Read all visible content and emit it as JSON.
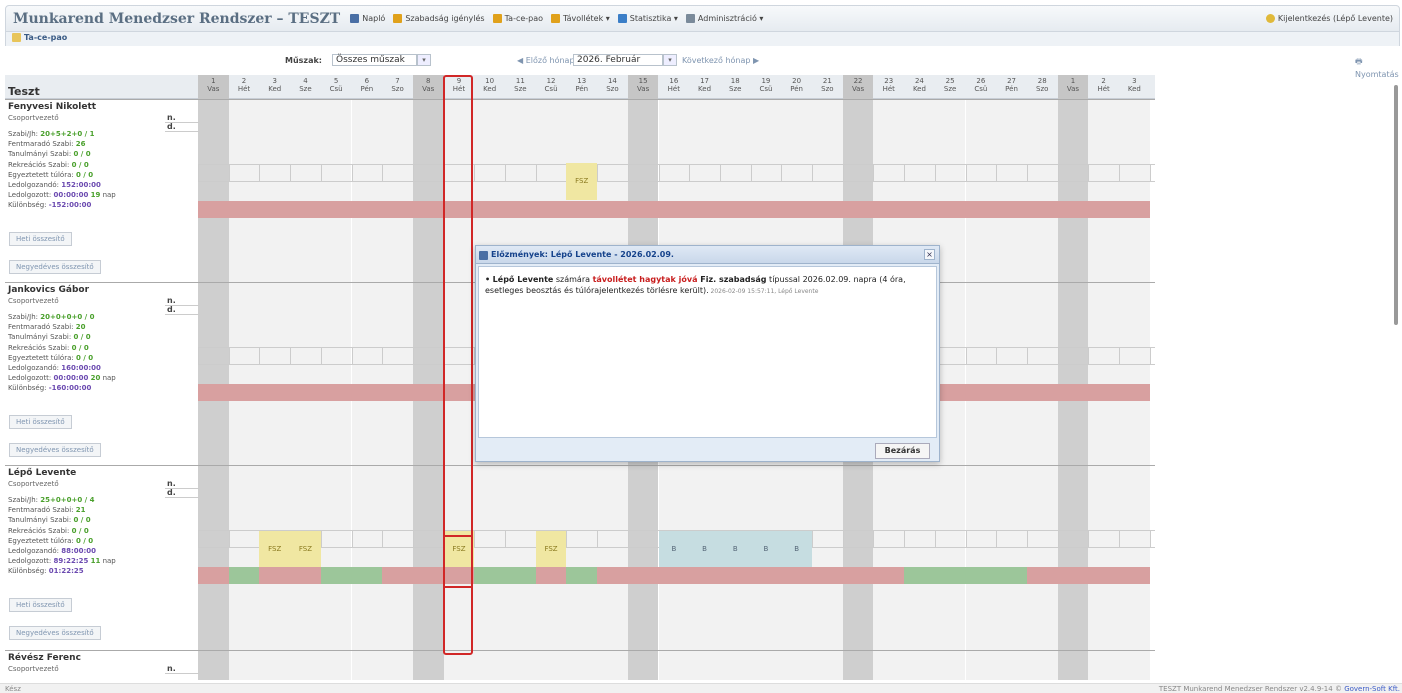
{
  "app": {
    "title": "Munkarend Menedzser Rendszer – TESZT",
    "logout": "Kijelentkezés (Lépő Levente)"
  },
  "menu": [
    {
      "label": "Napló",
      "icon": "book-icon",
      "color": "#4a6fa5"
    },
    {
      "label": "Szabadság igénylés",
      "icon": "home-icon",
      "color": "#e0a11b"
    },
    {
      "label": "Ta-ce-pao",
      "icon": "calendar-icon",
      "color": "#e0a11b"
    },
    {
      "label": "Távollétek ▾",
      "icon": "home-icon",
      "color": "#e0a11b"
    },
    {
      "label": "Statisztika ▾",
      "icon": "chart-icon",
      "color": "#3b7ec7"
    },
    {
      "label": "Adminisztráció ▾",
      "icon": "window-icon",
      "color": "#7a8a9a"
    }
  ],
  "tab": "Ta-ce-pao",
  "filters": {
    "shift_label": "Műszak:",
    "shift_value": "Összes műszak",
    "prev": "Előző hónap",
    "month": "2026. Február",
    "next": "Következő hónap",
    "print": "Nyomtatás"
  },
  "grid": {
    "title": "Teszt"
  },
  "days": [
    {
      "n": "1",
      "d": "Vas",
      "we": true
    },
    {
      "n": "2",
      "d": "Hét"
    },
    {
      "n": "3",
      "d": "Ked"
    },
    {
      "n": "4",
      "d": "Sze"
    },
    {
      "n": "5",
      "d": "Csü"
    },
    {
      "n": "6",
      "d": "Pén"
    },
    {
      "n": "7",
      "d": "Szo"
    },
    {
      "n": "8",
      "d": "Vas",
      "we": true
    },
    {
      "n": "9",
      "d": "Hét"
    },
    {
      "n": "10",
      "d": "Ked"
    },
    {
      "n": "11",
      "d": "Sze"
    },
    {
      "n": "12",
      "d": "Csü"
    },
    {
      "n": "13",
      "d": "Pén"
    },
    {
      "n": "14",
      "d": "Szo"
    },
    {
      "n": "15",
      "d": "Vas",
      "we": true
    },
    {
      "n": "16",
      "d": "Hét"
    },
    {
      "n": "17",
      "d": "Ked"
    },
    {
      "n": "18",
      "d": "Sze"
    },
    {
      "n": "19",
      "d": "Csü"
    },
    {
      "n": "20",
      "d": "Pén"
    },
    {
      "n": "21",
      "d": "Szo"
    },
    {
      "n": "22",
      "d": "Vas",
      "we": true
    },
    {
      "n": "23",
      "d": "Hét"
    },
    {
      "n": "24",
      "d": "Ked"
    },
    {
      "n": "25",
      "d": "Sze"
    },
    {
      "n": "26",
      "d": "Csü"
    },
    {
      "n": "27",
      "d": "Pén"
    },
    {
      "n": "28",
      "d": "Szo"
    },
    {
      "n": "1",
      "d": "Vas",
      "we": true
    },
    {
      "n": "2",
      "d": "Hét"
    },
    {
      "n": "3",
      "d": "Ked"
    }
  ],
  "people": [
    {
      "name": "Fenyvesi Nikolett",
      "role": "Csoportvezető",
      "s1": "Szabi/Jh:",
      "v1": "20+5+2+0 / 1",
      "s2": "Fentmaradó Szabi:",
      "v2": "26",
      "s3": "Tanulmányi Szabi:",
      "v3": "0 / 0",
      "s4": "Rekreációs Szabi:",
      "v4": "0 / 0",
      "s5": "Egyeztetett túlóra:",
      "v5": "0 / 0",
      "s6": "Ledolgozandó:",
      "v6": "152:00:00",
      "s7": "Ledolgozott:",
      "v7": "00:00:00",
      "v7b": "19",
      "v7c": "nap",
      "s8": "Különbség:",
      "v8": "-152:00:00"
    },
    {
      "name": "Jankovics Gábor",
      "role": "Csoportvezető",
      "s1": "Szabi/Jh:",
      "v1": "20+0+0+0 / 0",
      "s2": "Fentmaradó Szabi:",
      "v2": "20",
      "s3": "Tanulmányi Szabi:",
      "v3": "0 / 0",
      "s4": "Rekreációs Szabi:",
      "v4": "0 / 0",
      "s5": "Egyeztetett túlóra:",
      "v5": "0 / 0",
      "s6": "Ledolgozandó:",
      "v6": "160:00:00",
      "s7": "Ledolgozott:",
      "v7": "00:00:00",
      "v7b": "20",
      "v7c": "nap",
      "s8": "Különbség:",
      "v8": "-160:00:00"
    },
    {
      "name": "Lépő Levente",
      "role": "Csoportvezető",
      "s1": "Szabi/Jh:",
      "v1": "25+0+0+0 / 4",
      "s2": "Fentmaradó Szabi:",
      "v2": "21",
      "s3": "Tanulmányi Szabi:",
      "v3": "0 / 0",
      "s4": "Rekreációs Szabi:",
      "v4": "0 / 0",
      "s5": "Egyeztetett túlóra:",
      "v5": "0 / 0",
      "s6": "Ledolgozandó:",
      "v6": "88:00:00",
      "s7": "Ledolgozott:",
      "v7": "89:22:25",
      "v7b": "11",
      "v7c": "nap",
      "s8": "Különbség:",
      "v8": "01:22:25"
    },
    {
      "name": "Révész Ferenc",
      "role": "Csoportvezető"
    }
  ],
  "labels": {
    "n": "n.",
    "d": "d.",
    "weekly": "Heti összesítő",
    "quarterly": "Negyedéves összesítő",
    "fsz": "FSZ",
    "b": "B"
  },
  "dialog": {
    "title": "Előzmények: Lépő Levente - 2026.02.09.",
    "close": "×",
    "bullet": "•",
    "name": "Lépő Levente",
    "t1": " számára ",
    "hl": "távollétet hagytak jóvá",
    "type": " Fiz. szabadság",
    "t2": " típussal 2026.02.09. napra (4 óra, esetleges beosztás és túlórajelentkezés törlésre került).",
    "meta": " 2026-02-09 15:57:11, Lépő Levente",
    "button": "Bezárás"
  },
  "status": {
    "left": "Kész",
    "right_a": "TESZT   Munkarend Menedzser Rendszer v2.4.9-14 ©",
    "right_b": "Govern-Soft Kft."
  }
}
